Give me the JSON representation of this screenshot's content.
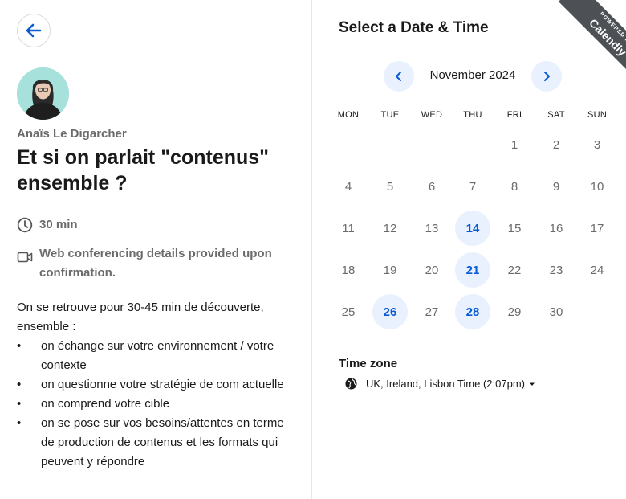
{
  "organizer": {
    "name": "Anaïs Le Digarcher",
    "avatar_icon": "person-avatar"
  },
  "event": {
    "title": "Et si on parlait \"contenus\" ensemble ?",
    "duration": "30 min",
    "duration_icon": "clock-icon",
    "conferencing": "Web conferencing details provided upon confirmation.",
    "conferencing_icon": "video-camera-icon",
    "description_intro": "On se retrouve pour 30-45 min de découverte, ensemble :",
    "description_items": [
      "on échange sur votre environnement / votre contexte",
      "on questionne votre stratégie de com actuelle",
      "on comprend votre cible",
      "on se pose sur vos besoins/attentes en terme de production de contenus et les formats qui peuvent y répondre"
    ]
  },
  "calendar": {
    "heading": "Select a Date & Time",
    "month_label": "November 2024",
    "weekdays": [
      "MON",
      "TUE",
      "WED",
      "THU",
      "FRI",
      "SAT",
      "SUN"
    ],
    "first_weekday_index": 4,
    "days_in_month": 30,
    "available_days": [
      14,
      21,
      26,
      28
    ]
  },
  "timezone": {
    "label": "Time zone",
    "value": "UK, Ireland, Lisbon Time (2:07pm)",
    "icon": "globe-icon"
  },
  "badge": {
    "small_text": "POWERED BY",
    "brand": "Calendly"
  },
  "colors": {
    "accent": "#0a5ad6",
    "available_bg": "#e8f1fd",
    "muted_text": "#6b6b6b",
    "ribbon": "#4d5055"
  }
}
